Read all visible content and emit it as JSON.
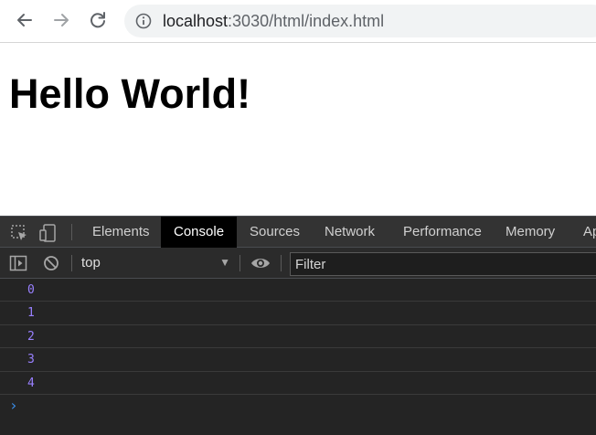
{
  "browser": {
    "url_host": "localhost",
    "url_rest": ":3030/html/index.html"
  },
  "page": {
    "heading": "Hello World!"
  },
  "devtools": {
    "tabs": [
      {
        "label": "Elements"
      },
      {
        "label": "Console",
        "active": true
      },
      {
        "label": "Sources"
      },
      {
        "label": "Network"
      },
      {
        "label": "Performance"
      },
      {
        "label": "Memory"
      },
      {
        "label": "Ap"
      }
    ],
    "toolbar": {
      "context": "top",
      "filter_placeholder": "Filter"
    },
    "console_logs": [
      "0",
      "1",
      "2",
      "3",
      "4"
    ],
    "prompt_symbol": "›"
  },
  "colors": {
    "devtools_bg": "#242424",
    "log_number": "#9980ff",
    "prompt": "#3b8eea",
    "active_tab": "#000000"
  },
  "icons": [
    "back-arrow-icon",
    "forward-arrow-icon",
    "reload-icon",
    "info-icon",
    "inspect-element-icon",
    "device-toggle-icon",
    "sidebar-toggle-icon",
    "clear-console-icon",
    "eye-icon",
    "dropdown-arrow-icon"
  ]
}
